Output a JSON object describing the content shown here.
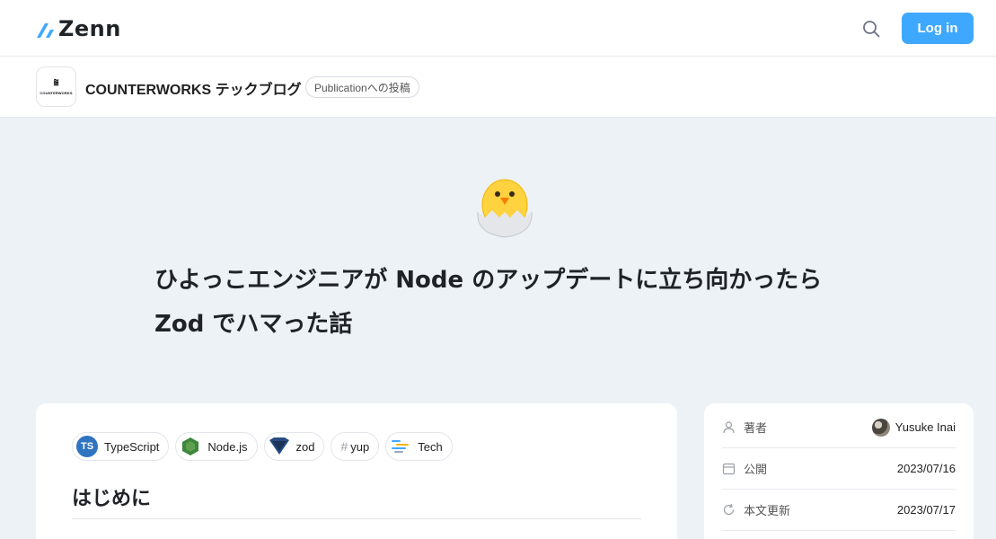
{
  "header": {
    "logo_text": "Zenn",
    "login_label": "Log in"
  },
  "publication": {
    "logo_word": "COUNTERWORKS",
    "name": "COUNTERWORKS テックブログ",
    "badge": "Publicationへの投稿"
  },
  "article": {
    "emoji": "🐣",
    "title_line1": "ひよっこエンジニアが Node のアップデートに立ち向かったら",
    "title_line2": "Zod でハマった話",
    "topics": [
      {
        "label": "TypeScript",
        "icon": "typescript-icon"
      },
      {
        "label": "Node.js",
        "icon": "nodejs-icon"
      },
      {
        "label": "zod",
        "icon": "zod-icon"
      },
      {
        "label": "yup",
        "icon": "hash-icon"
      },
      {
        "label": "Tech",
        "icon": "tech-icon"
      }
    ],
    "first_heading": "はじめに"
  },
  "sidebar": {
    "author_label": "著者",
    "author_name": "Yusuke Inai",
    "published_label": "公開",
    "published_date": "2023/07/16",
    "updated_label": "本文更新",
    "updated_date": "2023/07/17"
  },
  "colors": {
    "accent": "#3ea8ff",
    "background": "#edf2f7",
    "typescript": "#2f74c0"
  }
}
